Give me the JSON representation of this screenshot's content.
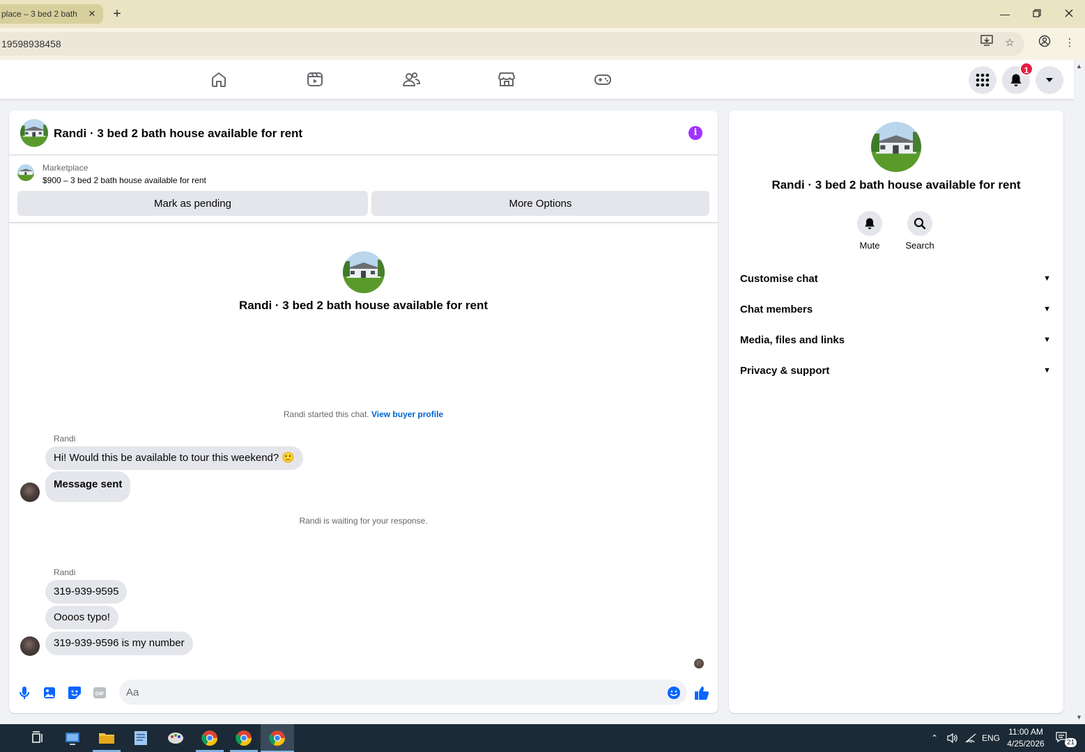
{
  "browser": {
    "tab_title": "place – 3 bed 2 bath",
    "tab_close": "✕",
    "new_tab": "+",
    "address": "19598938458",
    "window_controls": [
      "minimize-icon",
      "restore-icon",
      "close-icon"
    ]
  },
  "header": {
    "nav_icons": [
      "home-icon",
      "video-icon",
      "friends-icon",
      "marketplace-icon",
      "gaming-icon"
    ],
    "notification_count": "1"
  },
  "chat": {
    "title": "Randi · 3 bed 2 bath house available for rent",
    "marketplace_label": "Marketplace",
    "listing": "$900 – 3 bed 2 bath house available for rent",
    "mark_pending_label": "Mark as pending",
    "more_options_label": "More Options",
    "center_title": "Randi · 3 bed 2 bath house available for rent",
    "started_text": "Randi started this chat.",
    "view_profile_label": "View buyer profile",
    "sender_1": "Randi",
    "msg_1": "Hi! Would this be available to tour this weekend?",
    "msg_1_emoji": "🙂",
    "msg_sent": "Message sent",
    "waiting_text": "Randi is waiting for your response.",
    "sender_2": "Randi",
    "msg_2": "319-939-9595",
    "msg_3": "Oooos typo!",
    "msg_4": "319-939-9596 is my number",
    "composer_placeholder": "Aa",
    "gif_label": "GIF"
  },
  "info": {
    "title": "Randi · 3 bed 2 bath house available for rent",
    "mute_label": "Mute",
    "search_label": "Search",
    "sections": [
      "Customise chat",
      "Chat members",
      "Media, files and links",
      "Privacy & support"
    ]
  },
  "taskbar": {
    "lang": "ENG",
    "time": "11:00 AM",
    "date": "4/25/2026",
    "notif_count": "21"
  },
  "colors": {
    "accent": "#0866ff",
    "info_purple": "#a033ff",
    "badge_red": "#e41e3f",
    "bubble": "#e4e6eb"
  }
}
